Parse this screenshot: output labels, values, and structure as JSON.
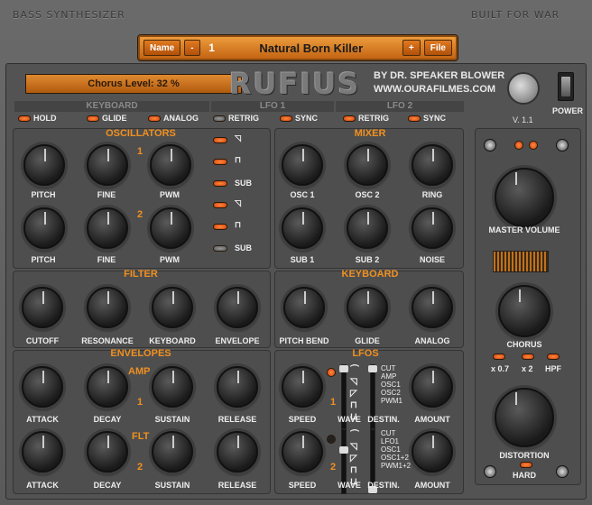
{
  "header": {
    "left": "BASS SYNTHESIZER",
    "right": "BUILT FOR WAR"
  },
  "preset": {
    "name_btn": "Name",
    "minus": "-",
    "number": "1",
    "name": "Natural Born Killer",
    "plus": "+",
    "file_btn": "File"
  },
  "display": "Chorus Level: 32 %",
  "logo": "RUFIUS",
  "byline": {
    "line1": "BY DR. SPEAKER BLOWER",
    "line2": "WWW.OURAFILMES.COM"
  },
  "version": "V. 1.1",
  "power": "POWER",
  "strips": {
    "keyboard": "KEYBOARD",
    "lfo1": "LFO 1",
    "lfo2": "LFO 2"
  },
  "toggles": {
    "hold": "HOLD",
    "glide": "GLIDE",
    "analog": "ANALOG",
    "retrig1": "RETRIG",
    "sync1": "SYNC",
    "retrig2": "RETRIG",
    "sync2": "SYNC"
  },
  "oscillators": {
    "title": "OSCILLATORS",
    "num1": "1",
    "num2": "2",
    "pitch": "PITCH",
    "fine": "FINE",
    "pwm": "PWM",
    "sub": "SUB"
  },
  "mixer": {
    "title": "MIXER",
    "osc1": "OSC 1",
    "osc2": "OSC 2",
    "ring": "RING",
    "sub1": "SUB 1",
    "sub2": "SUB 2",
    "noise": "NOISE"
  },
  "filter": {
    "title": "FILTER",
    "cutoff": "CUTOFF",
    "resonance": "RESONANCE",
    "keyboard": "KEYBOARD",
    "envelope": "ENVELOPE"
  },
  "keyboard": {
    "title": "KEYBOARD",
    "pitchbend": "PITCH BEND",
    "glide": "GLIDE",
    "analog": "ANALOG"
  },
  "envelopes": {
    "title": "ENVELOPES",
    "amp": "AMP",
    "flt": "FLT",
    "num1": "1",
    "num2": "2",
    "attack": "ATTACK",
    "decay": "DECAY",
    "sustain": "SUSTAIN",
    "release": "RELEASE"
  },
  "lfos": {
    "title": "LFOS",
    "num1": "1",
    "num2": "2",
    "speed": "SPEED",
    "wave": "WAVE",
    "destin": "DESTIN.",
    "amount": "AMOUNT",
    "dest1": [
      "CUT",
      "AMP",
      "OSC1",
      "OSC2",
      "PWM1"
    ],
    "dest2": [
      "CUT",
      "LFO1",
      "OSC1",
      "OSC1+2",
      "PWM1+2"
    ]
  },
  "master": {
    "volume": "MASTER VOLUME",
    "chorus": "CHORUS",
    "x07": "x 0.7",
    "x2": "x 2",
    "hpf": "HPF",
    "distortion": "DISTORTION",
    "hard": "HARD"
  }
}
